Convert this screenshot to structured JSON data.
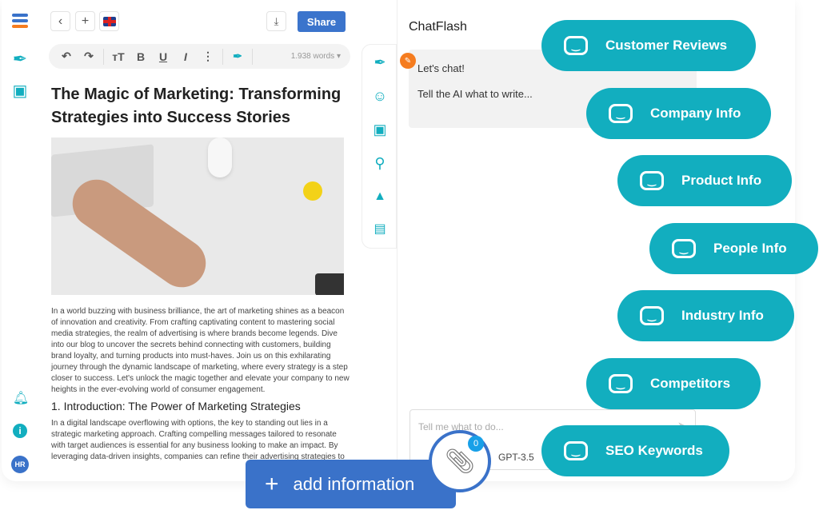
{
  "toolbar": {
    "share_label": "Share",
    "word_count": "1.938 words",
    "bold": "B",
    "underline": "U",
    "italic": "I",
    "text_size": "тT",
    "more": "⋮"
  },
  "document": {
    "title": "The Magic of Marketing: Transforming Strategies into Success Stories",
    "paragraph1": "In a world buzzing with business brilliance, the art of marketing shines as a beacon of innovation and creativity. From crafting captivating content to mastering social media strategies, the realm of advertising is where brands become legends. Dive into our blog to uncover the secrets behind connecting with customers, building brand loyalty, and turning products into must-haves. Join us on this exhilarating journey through the dynamic landscape of marketing, where every strategy is a step closer to success. Let's unlock the magic together and elevate your company to new heights in the ever-evolving world of consumer engagement.",
    "heading1": "1. Introduction: The Power of Marketing Strategies",
    "paragraph2": "In a digital landscape overflowing with options, the key to standing out lies in a strategic marketing approach. Crafting compelling messages tailored to resonate with target audiences is essential for any business looking to make an impact. By leveraging data-driven insights, companies can refine their advertising strategies to"
  },
  "user": {
    "initials": "HR"
  },
  "chat": {
    "title": "ChatFlash",
    "greeting": "Let's chat!",
    "prompt_hint": "Tell the AI what to write...",
    "input_placeholder": "Tell me what to do...",
    "model": "GPT-3.5"
  },
  "pills": [
    "Customer Reviews",
    "Company Info",
    "Product Info",
    "People Info",
    "Industry Info",
    "Competitors",
    "SEO Keywords"
  ],
  "add_button": {
    "label": "add information",
    "attachment_count": "0"
  },
  "colors": {
    "accent": "#12aebf",
    "primary": "#3a72c9",
    "orange": "#f57c1f"
  }
}
